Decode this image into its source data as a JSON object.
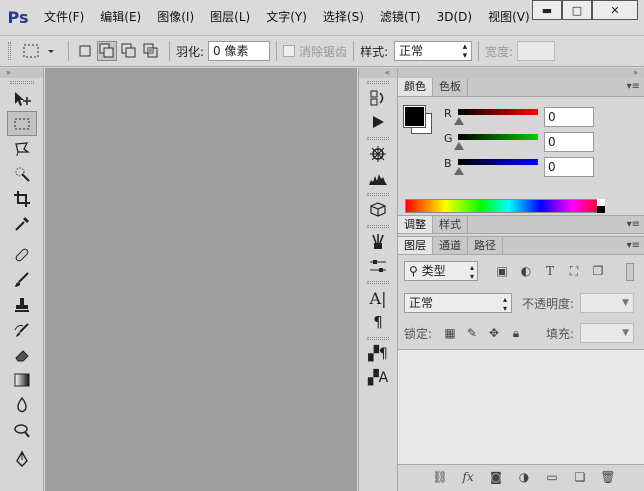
{
  "app": {
    "logo": "Ps"
  },
  "menu": {
    "items": [
      "文件(F)",
      "编辑(E)",
      "图像(I)",
      "图层(L)",
      "文字(Y)",
      "选择(S)",
      "滤镜(T)",
      "3D(D)",
      "视图(V)"
    ]
  },
  "window_controls": {
    "minimize": "▬",
    "maximize": "□",
    "close": "✕"
  },
  "options": {
    "feather_label": "羽化:",
    "feather_value": "0 像素",
    "antialias_label": "消除锯齿",
    "style_label": "样式:",
    "style_value": "正常",
    "width_label": "宽度:",
    "width_value": ""
  },
  "color_panel": {
    "tabs": [
      "颜色",
      "色板"
    ],
    "r_label": "R",
    "r_value": "0",
    "g_label": "G",
    "g_value": "0",
    "b_label": "B",
    "b_value": "0",
    "foreground": "#000000",
    "background": "#ffffff"
  },
  "adjust_panel": {
    "tabs": [
      "调整",
      "样式"
    ]
  },
  "layers_panel": {
    "tabs": [
      "图层",
      "通道",
      "路径"
    ],
    "filter_label": "类型",
    "blend_mode": "正常",
    "opacity_label": "不透明度:",
    "opacity_value": "",
    "lock_label": "锁定:",
    "fill_label": "填充:",
    "fill_value": ""
  },
  "icons": {
    "move": "move-icon",
    "marquee": "rect-marquee-icon"
  },
  "colors": {
    "chrome": "#d6d6d6",
    "canvas": "#9e9e9e",
    "logo": "#2a3a8c"
  }
}
